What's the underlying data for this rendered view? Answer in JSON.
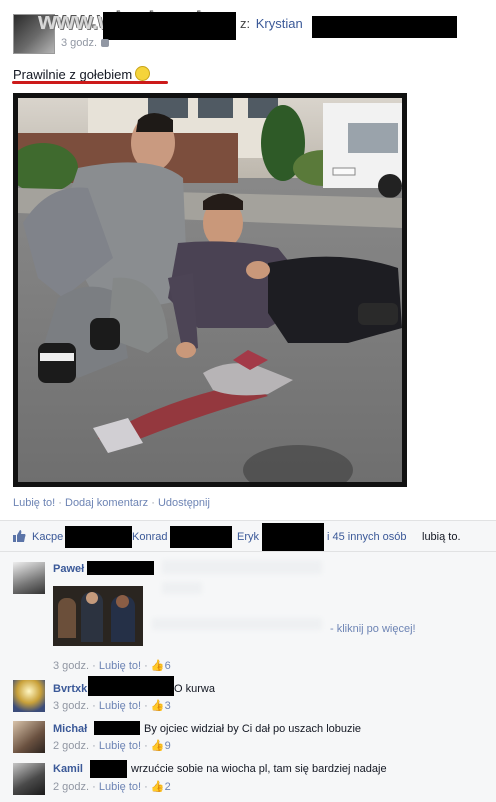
{
  "post": {
    "author_separator": "z:",
    "tagged_name": "Krystian",
    "time": "3 godz.",
    "text": "Prawilnie z gołebiem",
    "watermark": "www.wiocha.pl",
    "actions": [
      "Lubię to!",
      "Dodaj komentarz",
      "Udostępnij"
    ]
  },
  "likes": {
    "name1": "Kacpe",
    "name2": "Konrad",
    "name3": "Eryk",
    "others": "i 45 innych osób",
    "suffix": "lubią to."
  },
  "comments": [
    {
      "name": "Paweł",
      "text": "",
      "link": "- kliknij po więcej!",
      "time": "3 godz.",
      "like_label": "Lubię to!",
      "likes": "6"
    },
    {
      "name": "Bvrtxk",
      "text": "O kurwa",
      "time": "3 godz.",
      "like_label": "Lubię to!",
      "likes": "3"
    },
    {
      "name": "Michał",
      "text": "By ojciec widział by Ci dał po uszach lobuzie",
      "time": "2 godz.",
      "like_label": "Lubię to!",
      "likes": "9"
    },
    {
      "name": "Kamil",
      "text": "wrzućcie sobie na wiocha pl, tam się bardziej nadaje",
      "time": "2 godz.",
      "like_label": "Lubię to!",
      "likes": "2"
    }
  ],
  "colors": {
    "link": "#3b5998",
    "meta": "#9197a3",
    "underline": "#cc1a1a",
    "panel": "#f6f7f8"
  }
}
